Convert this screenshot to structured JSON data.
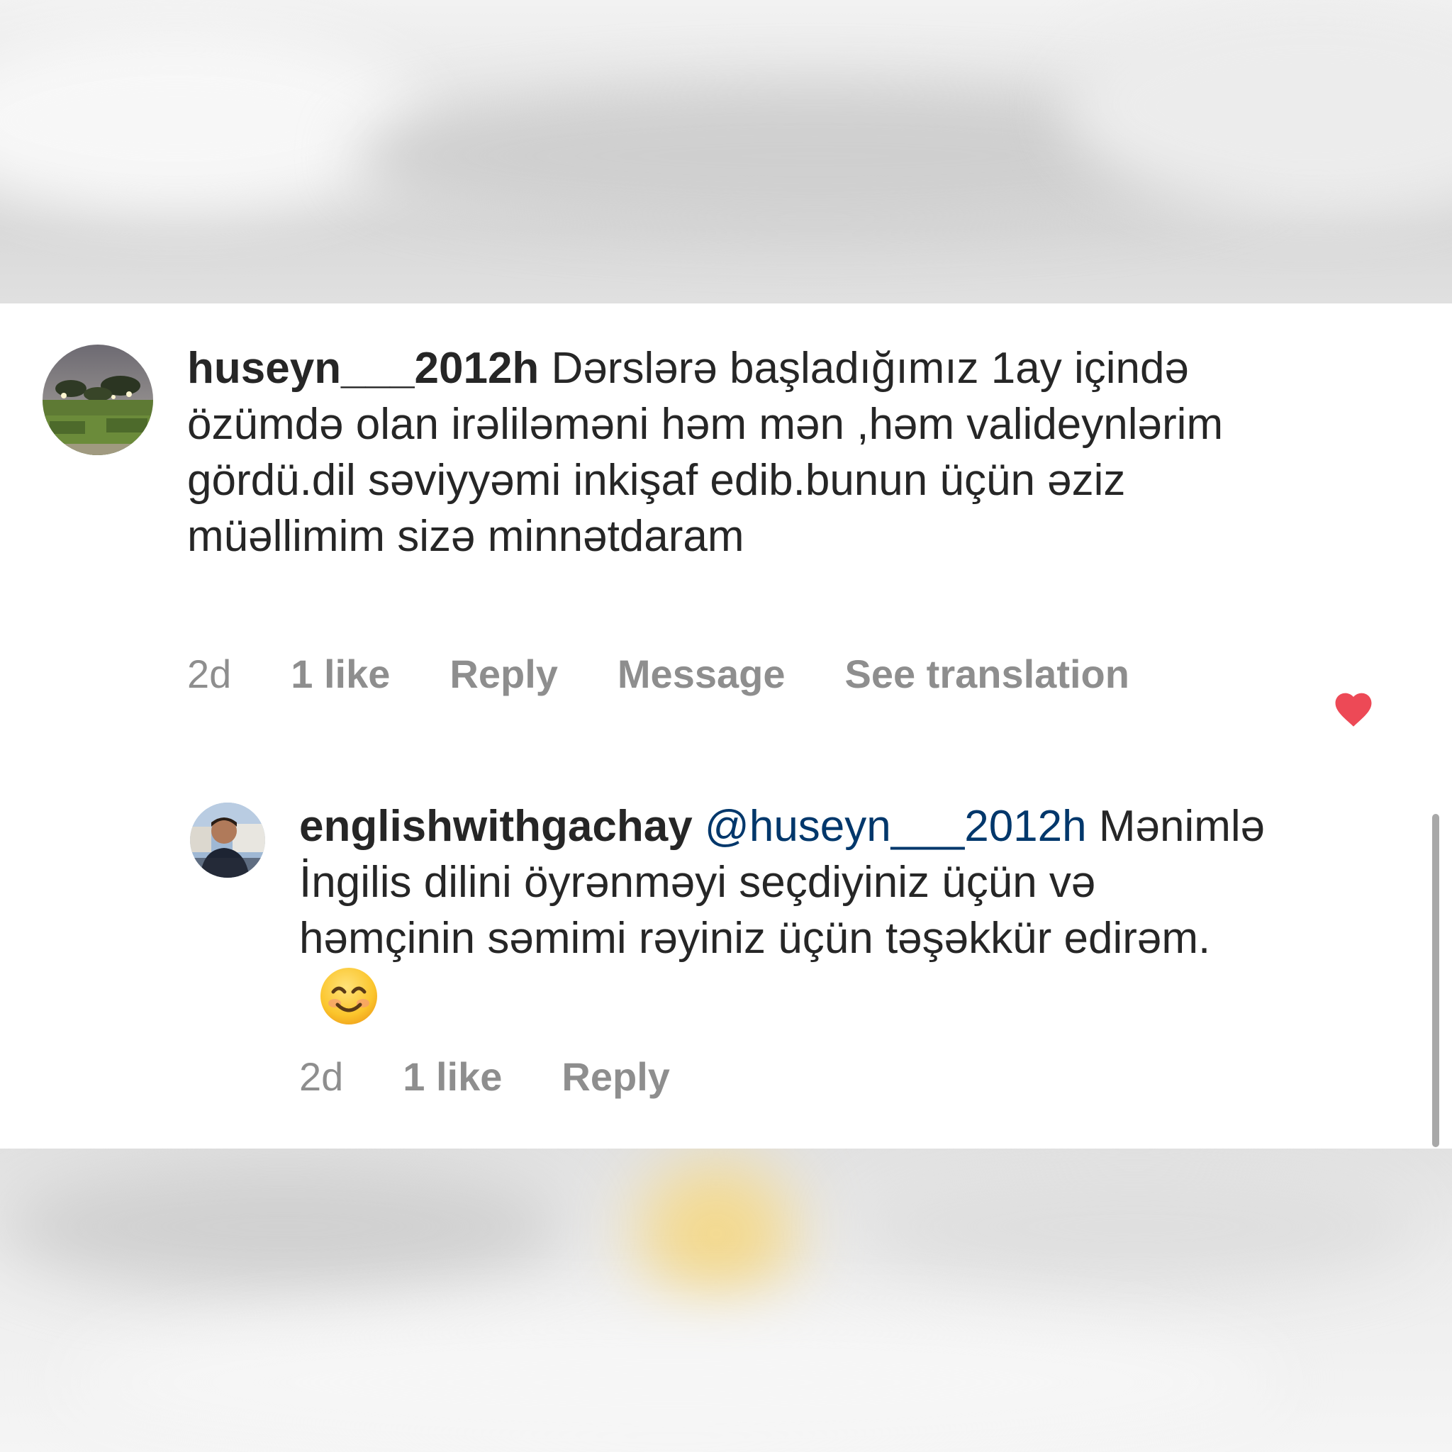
{
  "comments": [
    {
      "username": "huseyn___2012h",
      "text": " Dərslərə başladığımız 1ay içində özümdə olan irəliləməni həm mən ,həm valideynlərim gördü.dil səviyyəmi inkişaf edib.bunun üçün əziz müəllimim sizə minnətdaram",
      "time": "2d",
      "likes": "1 like",
      "reply": "Reply",
      "message": "Message",
      "translate": "See translation",
      "liked": true,
      "avatar_icon": "garden-photo-avatar"
    },
    {
      "username": "englishwithgachay",
      "mention": "@huseyn___2012h",
      "text": "Mənimlə İngilis dilini öyrənməyi seçdiyiniz üçün və həmçinin səmimi rəyiniz üçün təşəkkür edirəm.",
      "emoji": "😊",
      "time": "2d",
      "likes": "1 like",
      "reply": "Reply",
      "liked": false,
      "avatar_icon": "person-photo-avatar"
    }
  ],
  "colors": {
    "heart_filled": "#ed4956",
    "heart_outline": "#8e8e8e",
    "mention": "#00376b",
    "meta_text": "#8e8e8e",
    "body_text": "#262626"
  }
}
